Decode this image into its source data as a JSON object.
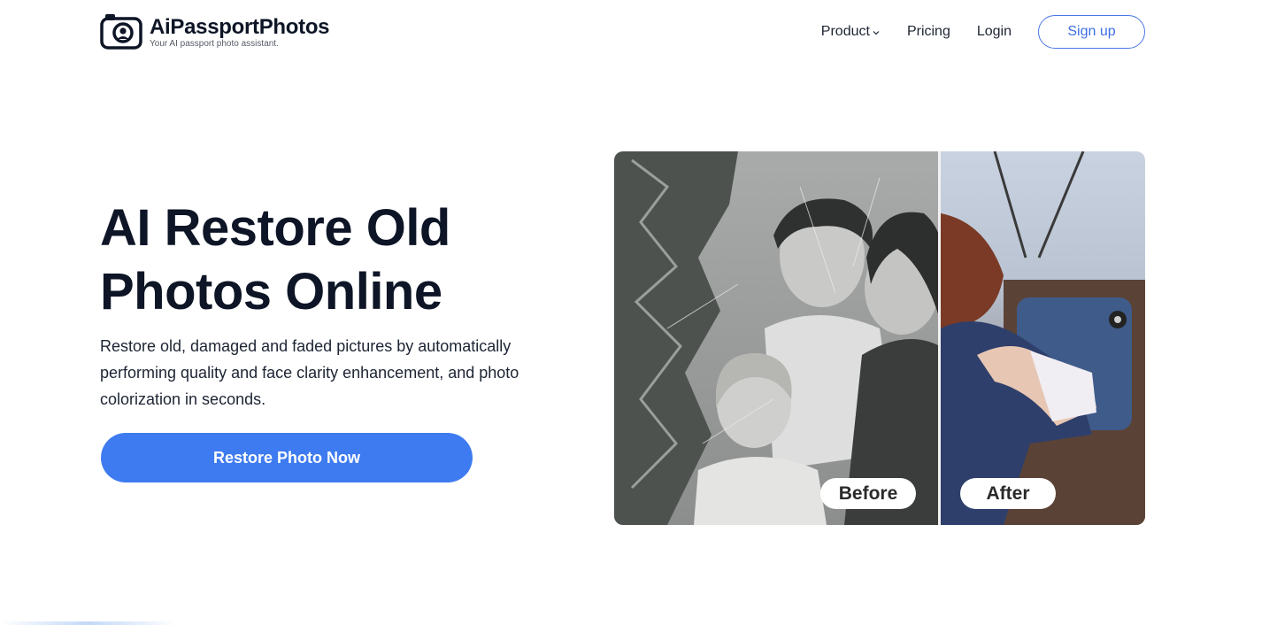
{
  "brand": {
    "name": "AiPassportPhotos",
    "tagline": "Your AI passport photo assistant."
  },
  "nav": {
    "product": "Product",
    "pricing": "Pricing",
    "login": "Login",
    "signup": "Sign up"
  },
  "hero": {
    "title_line1": "AI Restore Old",
    "title_line2": "Photos Online",
    "subtitle": "Restore old, damaged and faded pictures by automatically performing quality and face clarity enhancement, and photo colorization in seconds.",
    "cta": "Restore Photo Now"
  },
  "compare": {
    "before_label": "Before",
    "after_label": "After"
  },
  "colors": {
    "accent": "#3e7bf0",
    "text": "#0d1526"
  }
}
